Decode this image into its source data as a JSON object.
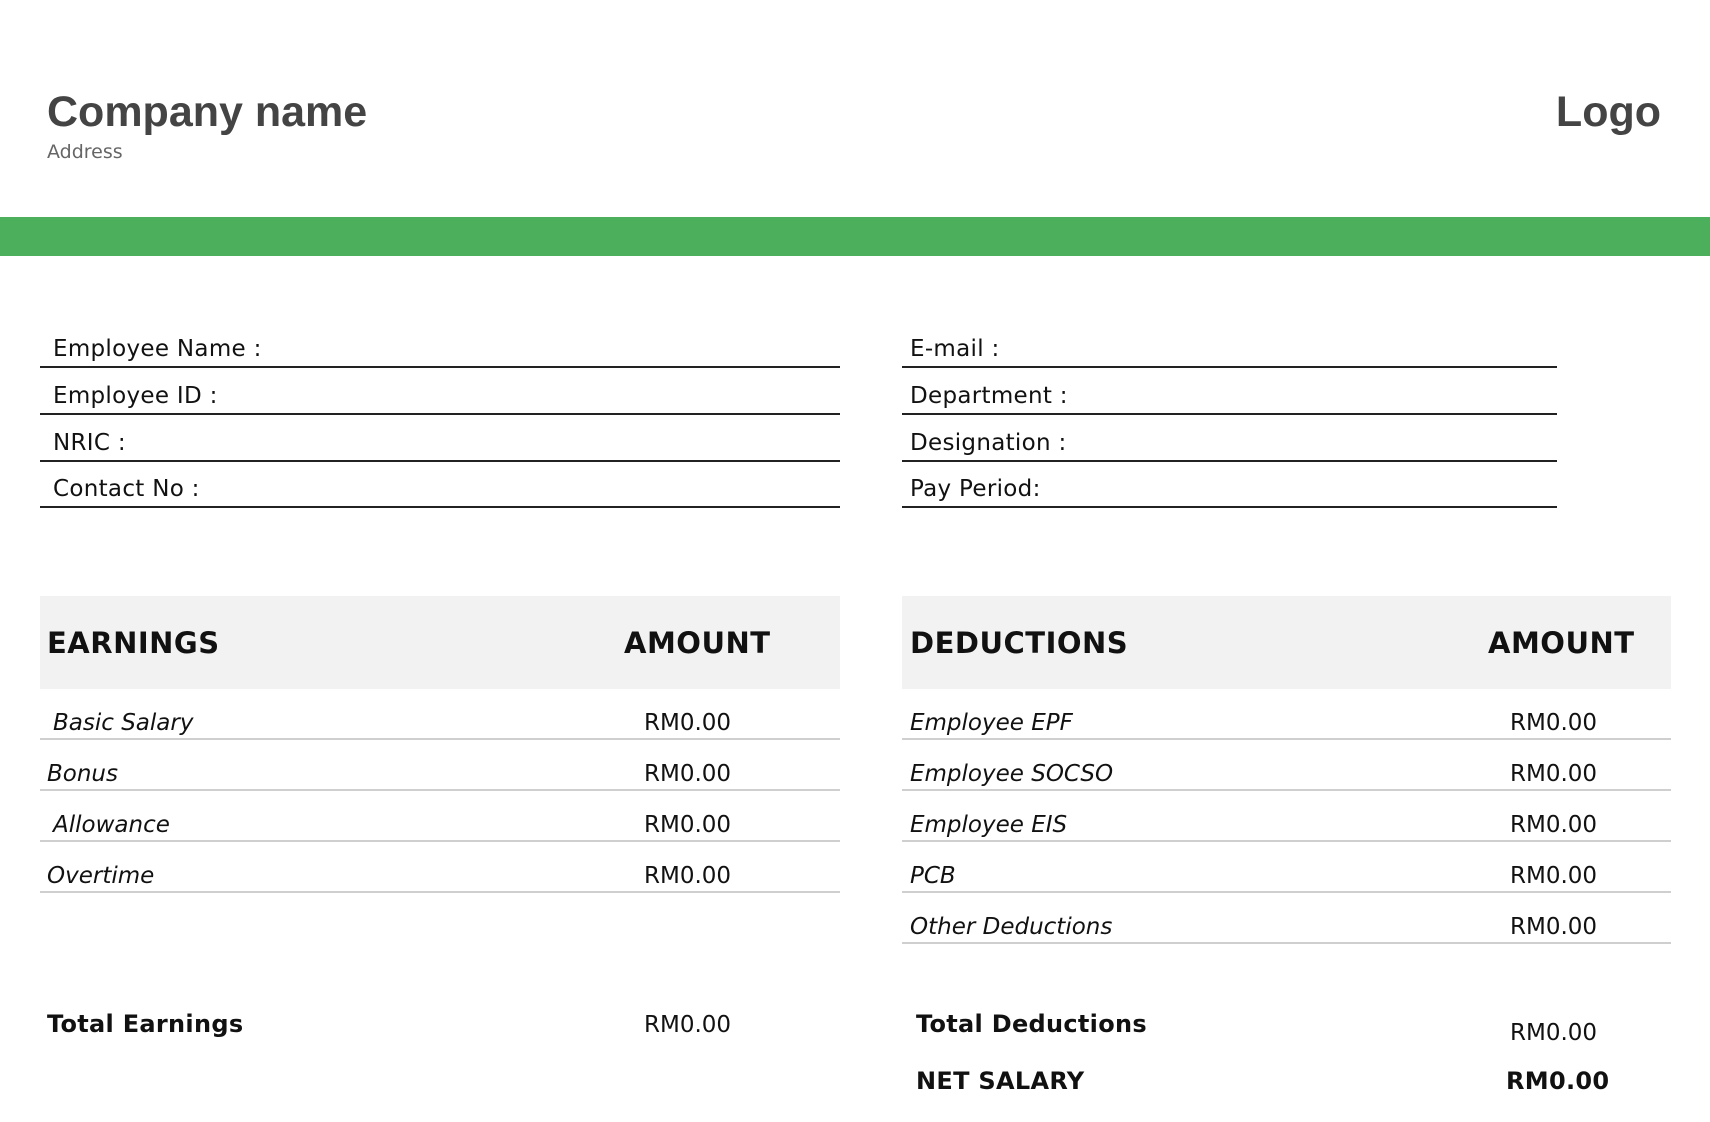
{
  "header": {
    "company_name": "Company name",
    "address": "Address",
    "logo": "Logo",
    "band_color": "#4caf5c"
  },
  "employee_fields": {
    "left": [
      "Employee Name :",
      "Employee ID :",
      "NRIC :",
      "Contact No :"
    ],
    "right": [
      "E-mail :",
      "Department :",
      "Designation :",
      "Pay Period:"
    ]
  },
  "earnings": {
    "header": "EARNINGS",
    "amount_header": "AMOUNT",
    "rows": [
      {
        "label": "Basic Salary",
        "amount": "RM0.00"
      },
      {
        "label": "Bonus",
        "amount": "RM0.00"
      },
      {
        "label": "Allowance",
        "amount": "RM0.00"
      },
      {
        "label": "Overtime",
        "amount": "RM0.00"
      }
    ],
    "total_label": "Total Earnings",
    "total_amount": "RM0.00"
  },
  "deductions": {
    "header": "DEDUCTIONS",
    "amount_header": "AMOUNT",
    "rows": [
      {
        "label": "Employee EPF",
        "amount": "RM0.00"
      },
      {
        "label": "Employee SOCSO",
        "amount": "RM0.00"
      },
      {
        "label": "Employee EIS",
        "amount": "RM0.00"
      },
      {
        "label": "PCB",
        "amount": "RM0.00"
      },
      {
        "label": "Other Deductions",
        "amount": "RM0.00"
      }
    ],
    "total_label": "Total Deductions",
    "total_amount": "RM0.00",
    "net_label": "NET SALARY",
    "net_amount": "RM0.00"
  }
}
